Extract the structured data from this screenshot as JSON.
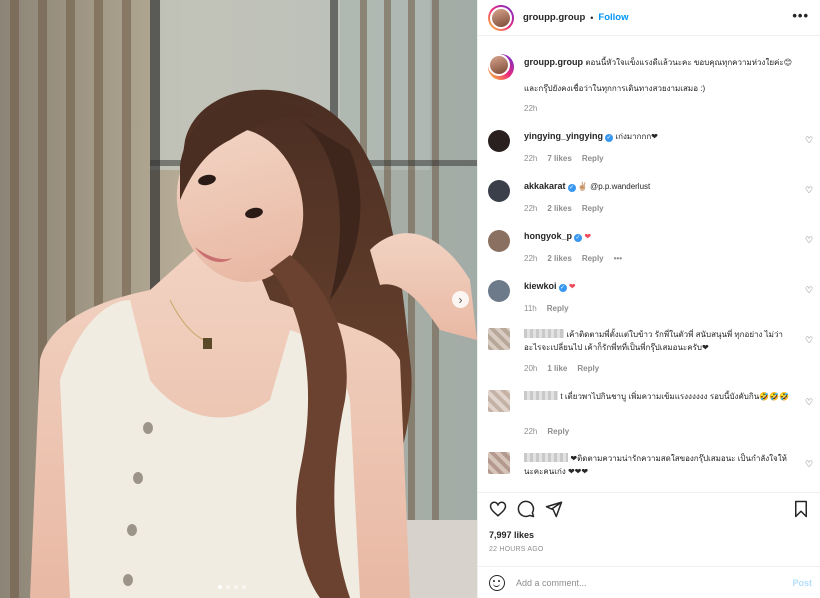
{
  "post": {
    "username": "groupp.group",
    "follow_label": "Follow",
    "separator": "•",
    "more_label": "•••",
    "next_label": "›"
  },
  "caption": {
    "username": "groupp.group",
    "line1": "ตอนนี้หัวใจแข็งแรงดีแล้วนะคะ ขอบคุณทุกความห่วงใยค่ะ😊",
    "line2": "และกรุ๊ปยังคงเชื่อว่าในทุกการเดินทางสวยงามเสมอ :)",
    "time": "22h"
  },
  "comments": [
    {
      "username": "yingying_yingying",
      "verified": true,
      "text": "เก่งมากกก❤",
      "time": "22h",
      "likes": "7 likes",
      "reply": "Reply",
      "avatar_color": "#2b2020"
    },
    {
      "username": "akkakarat",
      "verified": true,
      "text": "✌🏼 @p.p.wanderlust",
      "time": "22h",
      "likes": "2 likes",
      "reply": "Reply",
      "avatar_color": "#3a3f4a"
    },
    {
      "username": "hongyok_p",
      "verified": true,
      "text": "❤",
      "time": "22h",
      "likes": "2 likes",
      "reply": "Reply",
      "extra": "•••",
      "avatar_color": "#8a7060"
    },
    {
      "username": "kiewkoi",
      "verified": true,
      "text": "❤",
      "time": "11h",
      "likes": "",
      "reply": "Reply",
      "avatar_color": "#6d7a8a"
    },
    {
      "username": "",
      "verified": false,
      "text": "เค้าติดตามพี่ตั้งแต่ใบข้าว รักพี่ในตัวพี่ สนับสนุนพี่ ทุกอย่าง ไม่ว่าอะไรจะเปลี่ยนไป เค้าก็รักพี่ทที่เป็นพี่กรุ๊ปเสมอนะครับ❤",
      "time": "20h",
      "likes": "1 like",
      "reply": "Reply",
      "avatar_color": "#b8a89a"
    },
    {
      "username": "",
      "verified": false,
      "text": "t เตี่ยวพาไปกินชาบู เพิ่มความเข้มแรงงงงงง รอบนี้บังคับกิน🤣🤣🤣",
      "time": "22h",
      "likes": "",
      "reply": "Reply",
      "avatar_color": "#c4b2a6"
    },
    {
      "username": "",
      "verified": false,
      "text": "❤ติดตามความน่ารักความสดใสของกรุ๊ปเสมอนะ เป็นกำลังใจให้นะคะคนเก่ง ❤❤❤",
      "time": "",
      "likes": "",
      "reply": "",
      "avatar_color": "#b49a8e"
    }
  ],
  "actions": {
    "likes": "7,997 likes",
    "time_ago": "22 HOURS AGO"
  },
  "add_comment": {
    "placeholder": "Add a comment...",
    "post_label": "Post"
  },
  "colors": {
    "accent": "#0095f6",
    "verified": "#3897f0",
    "heart": "#ed4956",
    "muted": "#8e8e8e"
  }
}
